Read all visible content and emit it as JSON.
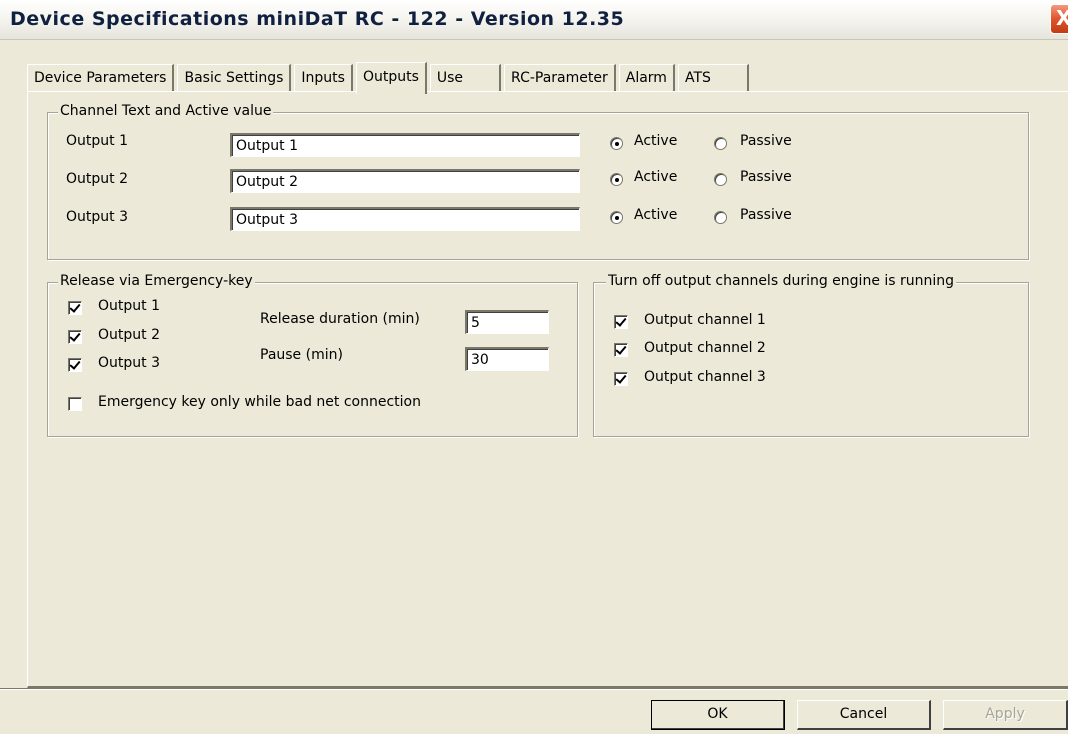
{
  "window": {
    "title": "Device Specifications miniDaT RC - 122 - Version 12.35",
    "close_glyph": "X"
  },
  "tabs": [
    {
      "label": "Device Parameters",
      "active": false
    },
    {
      "label": "Basic Settings",
      "active": false
    },
    {
      "label": "Inputs",
      "active": false
    },
    {
      "label": "Outputs",
      "active": true
    },
    {
      "label": "Use",
      "active": false
    },
    {
      "label": "RC-Parameter",
      "active": false
    },
    {
      "label": "Alarm",
      "active": false
    },
    {
      "label": "ATS",
      "active": false
    }
  ],
  "channel_group": {
    "title": "Channel Text and Active value",
    "rows": [
      {
        "label": "Output 1",
        "value": "Output 1",
        "active_label": "Active",
        "passive_label": "Passive",
        "selected": "Active"
      },
      {
        "label": "Output 2",
        "value": "Output 2",
        "active_label": "Active",
        "passive_label": "Passive",
        "selected": "Active"
      },
      {
        "label": "Output 3",
        "value": "Output 3",
        "active_label": "Active",
        "passive_label": "Passive",
        "selected": "Active"
      }
    ]
  },
  "release_group": {
    "title": "Release via Emergency-key",
    "outputs": [
      {
        "label": "Output 1",
        "checked": true
      },
      {
        "label": "Output 2",
        "checked": true
      },
      {
        "label": "Output 3",
        "checked": true
      }
    ],
    "duration_label": "Release duration (min)",
    "duration_value": "5",
    "pause_label": "Pause (min)",
    "pause_value": "30",
    "bad_net_label": "Emergency key only while bad net connection",
    "bad_net_checked": false
  },
  "engine_group": {
    "title": "Turn off output channels during engine is running",
    "channels": [
      {
        "label": "Output channel 1",
        "checked": true
      },
      {
        "label": "Output channel 2",
        "checked": true
      },
      {
        "label": "Output channel 3",
        "checked": true
      }
    ]
  },
  "buttons": {
    "ok": "OK",
    "cancel": "Cancel",
    "apply": "Apply"
  }
}
